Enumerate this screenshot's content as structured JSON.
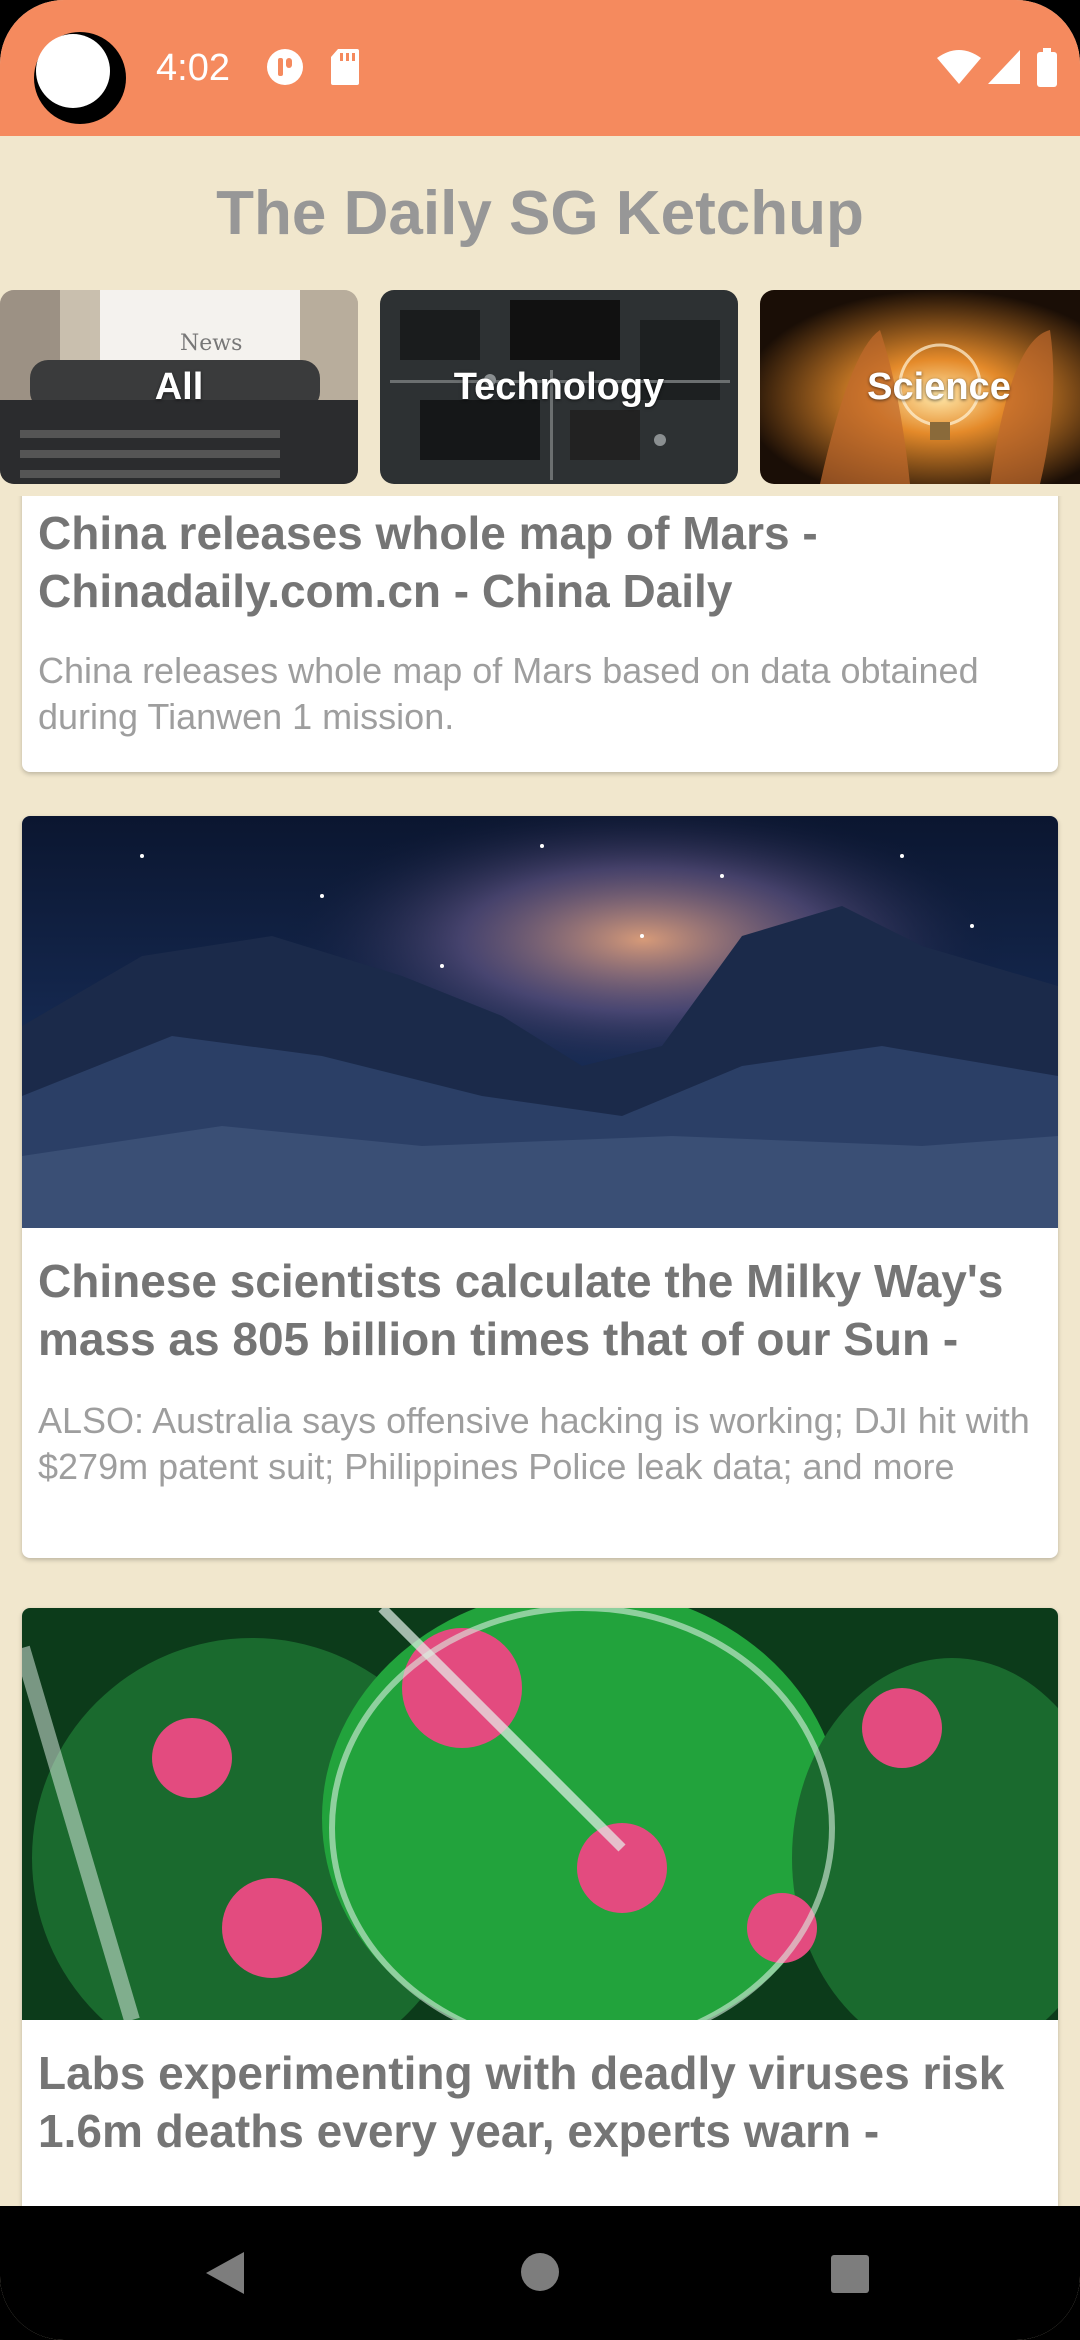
{
  "status_bar": {
    "time": "4:02",
    "icons": [
      "notification-icon",
      "sd-card-icon",
      "wifi-icon",
      "cell-signal-icon",
      "battery-icon"
    ],
    "background_color": "#f58a5e"
  },
  "header": {
    "title": "The Daily SG Ketchup"
  },
  "categories": [
    {
      "label": "All"
    },
    {
      "label": "Technology"
    },
    {
      "label": "Science"
    }
  ],
  "articles": [
    {
      "title": "China releases whole map of Mars - Chinadaily.com.cn - China Daily",
      "description": "China releases whole map of Mars based on data obtained during Tianwen 1 mission."
    },
    {
      "title": "Chinese scientists calculate the Milky Way's mass as 805 billion times that of our Sun -",
      "description": "ALSO: Australia says offensive hacking is working; DJI hit with $279m patent suit; Philippines Police leak data; and more"
    },
    {
      "title": "Labs experimenting with deadly viruses risk 1.6m deaths every year, experts warn -",
      "description": ""
    }
  ],
  "nav_bar": {
    "icons": [
      "back-icon",
      "home-icon",
      "recents-icon"
    ]
  },
  "colors": {
    "background": "#f1e7cd",
    "title": "#979797",
    "card_title": "#757575",
    "card_text": "#9e9e9e"
  }
}
